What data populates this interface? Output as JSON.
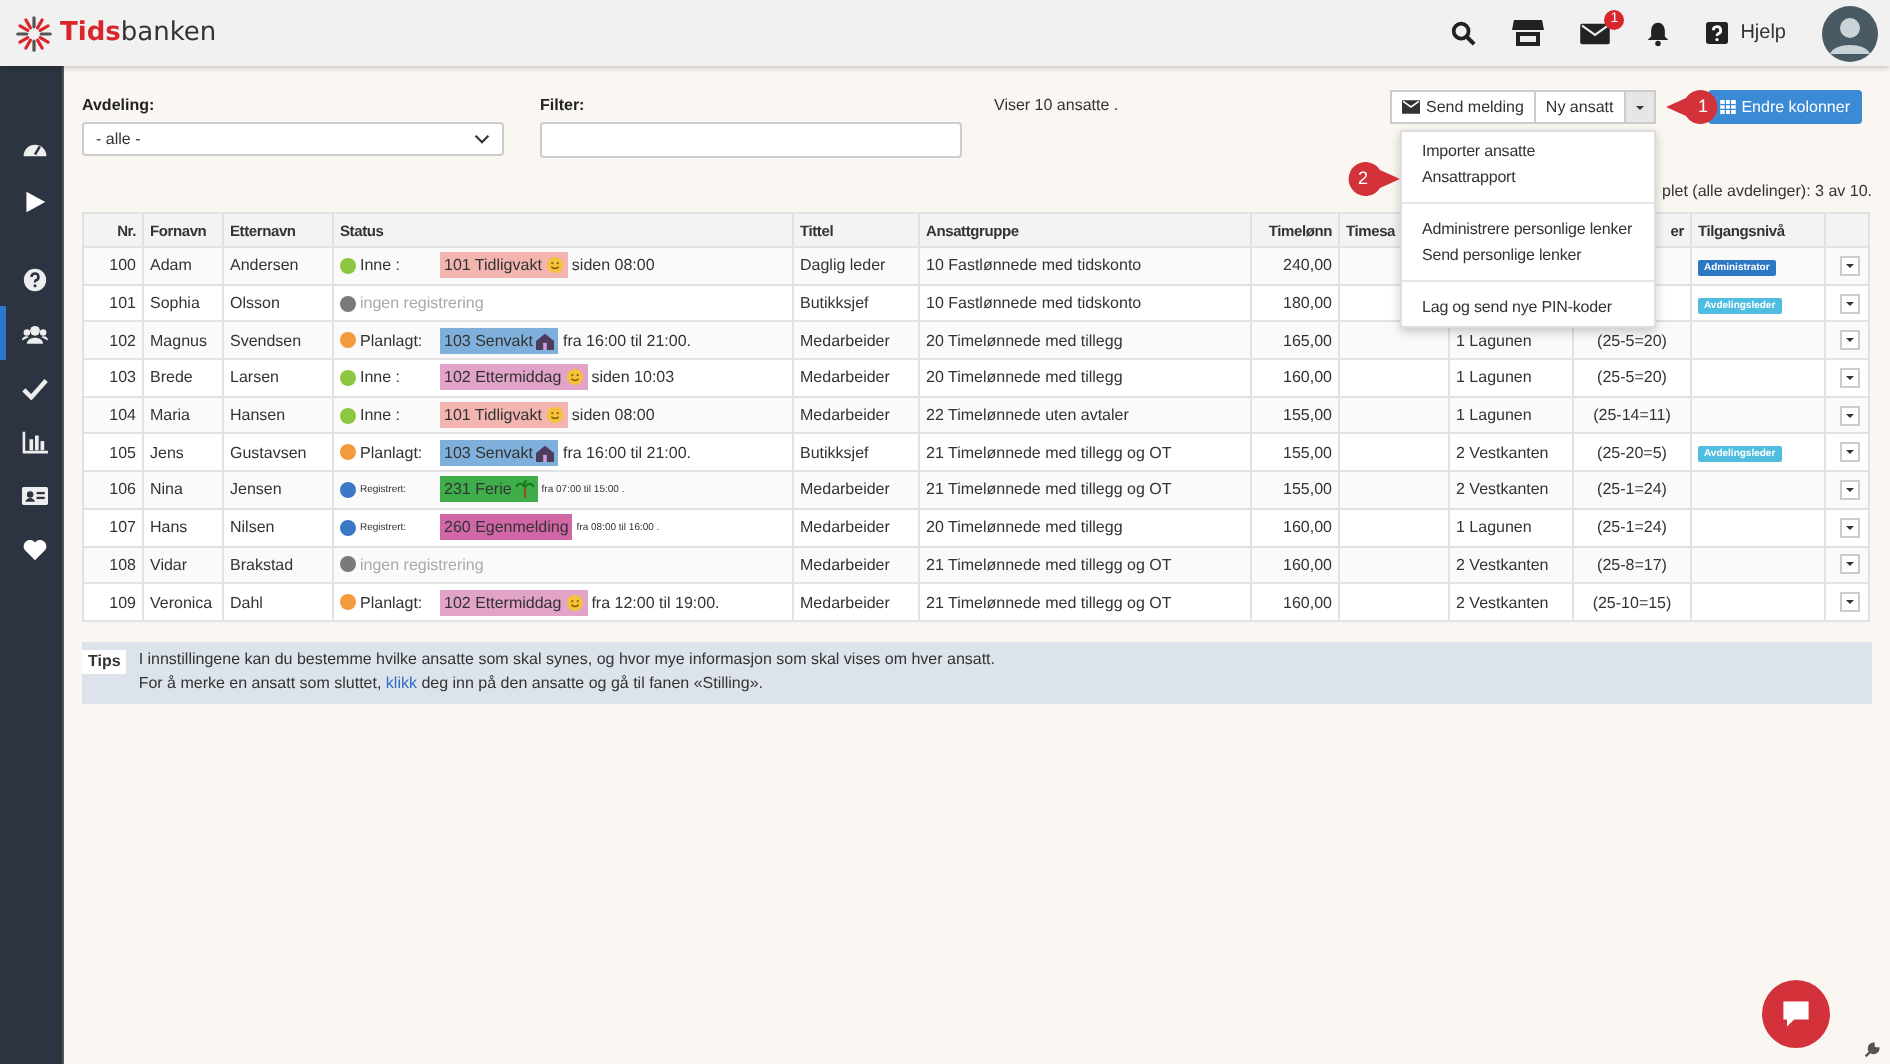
{
  "brand": {
    "part_1": "Tids",
    "part_2": "banken"
  },
  "top_icons": [
    {
      "kind": "search"
    },
    {
      "kind": "store"
    },
    {
      "kind": "mail",
      "badge": "1"
    },
    {
      "kind": "bell"
    },
    {
      "kind": "help",
      "label": "Hjelp"
    },
    {
      "kind": "avatar"
    }
  ],
  "sidebar": {
    "items": [
      {
        "kind": "dashboard",
        "selected": false
      },
      {
        "kind": "play",
        "selected": false
      },
      {
        "kind": "help",
        "selected": false
      },
      {
        "kind": "users",
        "selected": true
      },
      {
        "kind": "check",
        "selected": false
      },
      {
        "kind": "chart",
        "selected": false
      },
      {
        "kind": "card",
        "selected": false
      },
      {
        "kind": "heart",
        "selected": false
      }
    ]
  },
  "filters": {
    "department_label": "Avdeling:",
    "department_value": "- alle -",
    "filter_label": "Filter:",
    "count_text": "Viser 10 ansatte ."
  },
  "toolbar": {
    "send_button": "Send melding",
    "new_button": "Ny ansatt",
    "columns_button": "Endre kolonner"
  },
  "menu": {
    "groups": [
      [
        "Importer ansatte",
        "Ansattrapport"
      ],
      [
        "Administrere personlige lenker",
        "Send personlige lenker"
      ],
      [
        "Lag og send nye PIN-koder"
      ]
    ]
  },
  "callouts": [
    {
      "label": "1",
      "kind": "left"
    },
    {
      "label": "2",
      "kind": "right"
    }
  ],
  "summary_partial": "plet (alle avdelinger): 3 av 10.",
  "table": {
    "columns": [
      {
        "label": "Nr."
      },
      {
        "label": "Fornavn"
      },
      {
        "label": "Etternavn"
      },
      {
        "label": "Status"
      },
      {
        "label": "Tittel"
      },
      {
        "label": "Ansattgruppe"
      },
      {
        "label": "Timelønn"
      },
      {
        "label": "Timesa"
      },
      {},
      {
        "label": "er"
      },
      {
        "label": "Tilgangsnivå"
      },
      {}
    ],
    "rows": [
      {
        "nr": "100",
        "first": "Adam",
        "last": "Andersen",
        "status": {
          "kind": "in",
          "color": "#8dc63f",
          "label": "Inne :",
          "tag": {
            "label": "101 Tidligvakt",
            "color": "#f2b5b0",
            "kind": "smile"
          },
          "suffix": "siden 08:00"
        },
        "title": "Daglig leder",
        "group": "10 Fastlønnede med tidskonto",
        "wage": "240,00",
        "access": {
          "label": "Administrator",
          "color": "#2d78c4"
        }
      },
      {
        "nr": "101",
        "first": "Sophia",
        "last": "Olsson",
        "status": {
          "kind": "none",
          "color": "#7a7a7a",
          "label": "ingen registrering"
        },
        "title": "Butikksjef",
        "group": "10 Fastlønnede med tidskonto",
        "wage": "180,00",
        "access": {
          "label": "Avdelingsleder",
          "color": "#4fbde0"
        }
      },
      {
        "nr": "102",
        "first": "Magnus",
        "last": "Svendsen",
        "status": {
          "kind": "planned",
          "color": "#f39a3c",
          "label": "Planlagt:",
          "tag": {
            "label": "103 Senvakt",
            "color": "#7fb0db",
            "kind": "house"
          },
          "suffix": "fra 16:00 til 21:00."
        },
        "title": "Medarbeider",
        "group": "20 Timelønnede med tillegg",
        "wage": "165,00",
        "dept": "1 Lagunen",
        "column_10": "(25-5=20)"
      },
      {
        "nr": "103",
        "first": "Brede",
        "last": "Larsen",
        "status": {
          "kind": "in",
          "color": "#8dc63f",
          "label": "Inne :",
          "tag": {
            "label": "102 Ettermiddag",
            "color": "#e2a3c9",
            "kind": "smile"
          },
          "suffix": "siden 10:03"
        },
        "title": "Medarbeider",
        "group": "20 Timelønnede med tillegg",
        "wage": "160,00",
        "dept": "1 Lagunen",
        "column_10": "(25-5=20)"
      },
      {
        "nr": "104",
        "first": "Maria",
        "last": "Hansen",
        "status": {
          "kind": "in",
          "color": "#8dc63f",
          "label": "Inne :",
          "tag": {
            "label": "101 Tidligvakt",
            "color": "#f2b5b0",
            "kind": "smile"
          },
          "suffix": "siden 08:00"
        },
        "title": "Medarbeider",
        "group": "22 Timelønnede uten avtaler",
        "wage": "155,00",
        "dept": "1 Lagunen",
        "column_10": "(25-14=11)"
      },
      {
        "nr": "105",
        "first": "Jens",
        "last": "Gustavsen",
        "status": {
          "kind": "planned",
          "color": "#f39a3c",
          "label": "Planlagt:",
          "tag": {
            "label": "103 Senvakt",
            "color": "#7fb0db",
            "kind": "house"
          },
          "suffix": "fra 16:00 til 21:00."
        },
        "title": "Butikksjef",
        "group": "21 Timelønnede med tillegg og OT",
        "wage": "155,00",
        "dept": "2 Vestkanten",
        "column_10": "(25-20=5)",
        "access": {
          "label": "Avdelingsleder",
          "color": "#4fbde0"
        }
      },
      {
        "nr": "106",
        "first": "Nina",
        "last": "Jensen",
        "status": {
          "kind": "registered",
          "color": "#3b78c8",
          "label": "Registrert:",
          "tag": {
            "label": "231 Ferie",
            "color": "#3fae4a",
            "kind": "palm"
          },
          "suffix": "fra 07:00 til 15:00 ."
        },
        "title": "Medarbeider",
        "group": "21 Timelønnede med tillegg og OT",
        "wage": "155,00",
        "dept": "2 Vestkanten",
        "column_10": "(25-1=24)"
      },
      {
        "nr": "107",
        "first": "Hans",
        "last": "Nilsen",
        "status": {
          "kind": "registered",
          "color": "#3b78c8",
          "label": "Registrert:",
          "tag": {
            "label": "260 Egenmelding",
            "color": "#d267a8",
            "kind": "plain"
          },
          "suffix": "fra 08:00 til 16:00 ."
        },
        "title": "Medarbeider",
        "group": "20 Timelønnede med tillegg",
        "wage": "160,00",
        "dept": "1 Lagunen",
        "column_10": "(25-1=24)"
      },
      {
        "nr": "108",
        "first": "Vidar",
        "last": "Brakstad",
        "status": {
          "kind": "none",
          "color": "#7a7a7a",
          "label": "ingen registrering"
        },
        "title": "Medarbeider",
        "group": "21 Timelønnede med tillegg og OT",
        "wage": "160,00",
        "dept": "2 Vestkanten",
        "column_10": "(25-8=17)"
      },
      {
        "nr": "109",
        "first": "Veronica",
        "last": "Dahl",
        "status": {
          "kind": "planned",
          "color": "#f39a3c",
          "label": "Planlagt:",
          "tag": {
            "label": "102 Ettermiddag",
            "color": "#e2a3c9",
            "kind": "smile"
          },
          "suffix": "fra 12:00 til 19:00."
        },
        "title": "Medarbeider",
        "group": "21 Timelønnede med tillegg og OT",
        "wage": "160,00",
        "dept": "2 Vestkanten",
        "column_10": "(25-10=15)"
      }
    ]
  },
  "tips": {
    "label": "Tips",
    "line_1": "I innstillingene kan du bestemme hvilke ansatte som skal synes, og hvor mye informasjon som skal vises om hver ansatt.",
    "line_2": {
      "before": "For å merke en ansatt som sluttet, ",
      "link": "klikk",
      "after": " deg inn på den ansatte og gå til fanen «Stilling»."
    }
  }
}
